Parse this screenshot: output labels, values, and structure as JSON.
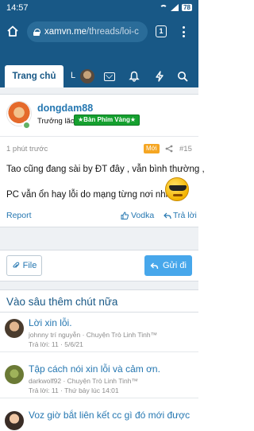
{
  "status_bar": {
    "time": "14:57",
    "battery": "78"
  },
  "browser": {
    "url_host": "xamvn.me",
    "url_path": "/threads/loi-c",
    "tab_count": "1"
  },
  "nav": {
    "active_tab": "Trang chủ",
    "second_tab_fragment": "L"
  },
  "post": {
    "username": "dongdam88",
    "user_title": "Trưởng lão",
    "banner": "★Bàn Phím Vàng★",
    "time": "1 phút trước",
    "new_badge": "Mới",
    "post_number": "#15",
    "message_line1": "Tao cũng đang sài by ĐT đây , vẫn bình thường ,",
    "message_line2": "PC vẫn ổn hay lỗi do mạng từng nơi nhỉ .",
    "report": "Report",
    "like": "Vodka",
    "reply": "Trả lời"
  },
  "reply_bar": {
    "file": "File",
    "send": "Gửi đi"
  },
  "similar": {
    "title": "Vào sâu thêm chút nữa",
    "items": [
      {
        "title": "Lời xin lỗi.",
        "meta1": "johnny trí nguyễn · Chuyện Trò Linh Tinh™",
        "meta2": "Trả lời: 11 · 5/6/21"
      },
      {
        "title": "Tập cách nói xin lỗi và cảm ơn.",
        "meta1": "darkwolf92 · Chuyện Trò Linh Tinh™",
        "meta2": "Trả lời: 11 · Thứ bảy lúc 14:01"
      },
      {
        "title": "Voz giờ bắt liên kết cc gì đó mới được",
        "meta1": "",
        "meta2": ""
      }
    ]
  }
}
